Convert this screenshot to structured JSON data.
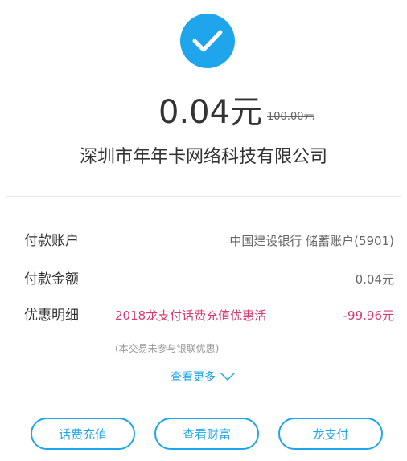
{
  "status": {
    "icon": "checkmark-icon",
    "accent_color": "#1ea5eb"
  },
  "payment": {
    "amount": "0.04元",
    "original_amount": "100.00元",
    "merchant": "深圳市年年卡网络科技有限公司"
  },
  "details": {
    "account": {
      "label": "付款账户",
      "value": "中国建设银行 储蓄账户(5901)"
    },
    "amount": {
      "label": "付款金额",
      "value": "0.04元"
    },
    "promotion": {
      "label": "优惠明细",
      "name": "2018龙支付话费充值优惠活",
      "value": "-99.96元",
      "color": "#d63b6e",
      "note": "(本交易未参与银联优惠)"
    }
  },
  "see_more": {
    "label": "查看更多",
    "icon": "chevron-down-icon"
  },
  "actions": [
    {
      "label": "话费充值"
    },
    {
      "label": "查看财富"
    },
    {
      "label": "龙支付"
    }
  ]
}
